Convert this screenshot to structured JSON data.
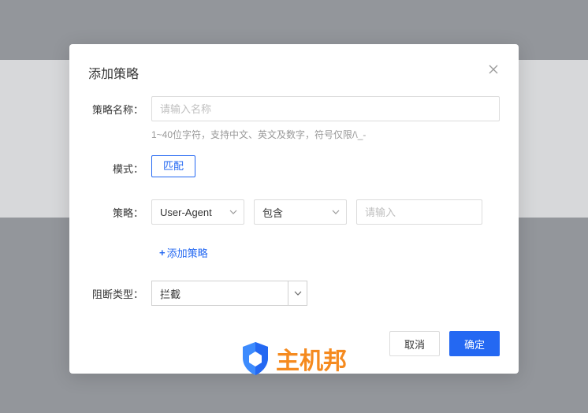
{
  "modal": {
    "title": "添加策略",
    "name": {
      "label": "策略名称：",
      "placeholder": "请输入名称",
      "hint": "1~40位字符，支持中文、英文及数字，符号仅限/\\_-"
    },
    "mode": {
      "label": "模式：",
      "value": "匹配"
    },
    "policy": {
      "label": "策略：",
      "field_value": "User-Agent",
      "operator_value": "包含",
      "value_placeholder": "请输入",
      "add_label": "添加策略"
    },
    "block": {
      "label": "阻断类型：",
      "value": "拦截"
    },
    "footer": {
      "cancel": "取消",
      "confirm": "确定"
    }
  },
  "watermark": {
    "text": "主机邦"
  }
}
